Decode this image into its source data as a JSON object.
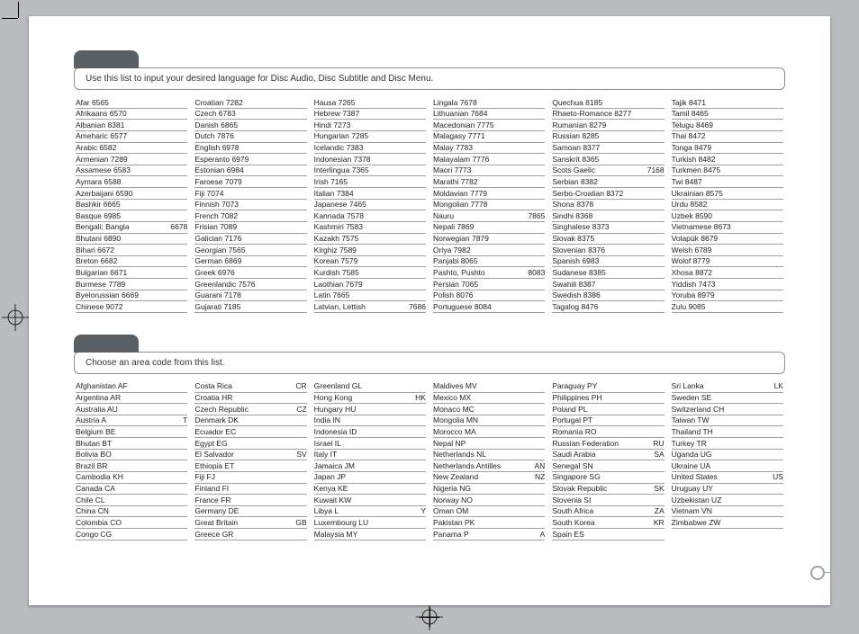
{
  "lang": {
    "instruction": "Use this list to input your desired language for Disc  Audio, Disc Subtitle and Disc Menu.",
    "cols": [
      [
        {
          "l": "Afar 6565"
        },
        {
          "l": "Afrikaans 6570"
        },
        {
          "l": "Albanian 8381"
        },
        {
          "l": "Ameharic 6577"
        },
        {
          "l": "Arabic 6582"
        },
        {
          "l": "Armenian 7289"
        },
        {
          "l": "Assamese 6583"
        },
        {
          "l": "Aymara 6588"
        },
        {
          "l": "Azerbaijani 6590"
        },
        {
          "l": "Bashkir 6665"
        },
        {
          "l": "Basque 6985"
        },
        {
          "l": "Bengali; Bangla",
          "r": "6678"
        },
        {
          "l": "Bhutani 6890"
        },
        {
          "l": "Bihari 6672"
        },
        {
          "l": "Breton 6682"
        },
        {
          "l": "Bulgarian 6671"
        },
        {
          "l": "Burmese 7789"
        },
        {
          "l": "Byelorussian 6669"
        },
        {
          "l": "Chinese 9072"
        }
      ],
      [
        {
          "l": "Croatian 7282"
        },
        {
          "l": "Czech 6783"
        },
        {
          "l": "Danish 6865"
        },
        {
          "l": "Dutch 7876"
        },
        {
          "l": "English 6978"
        },
        {
          "l": "Esperanto 6979"
        },
        {
          "l": "Estonian 6984"
        },
        {
          "l": "Faroese 7079"
        },
        {
          "l": "Fiji 7074"
        },
        {
          "l": "Finnish 7073"
        },
        {
          "l": "French 7082"
        },
        {
          "l": "Frisian 7089"
        },
        {
          "l": "Galician 7176"
        },
        {
          "l": "Georgian 7565"
        },
        {
          "l": "German 6869"
        },
        {
          "l": "Greek 6976"
        },
        {
          "l": "Greenlandic 7576"
        },
        {
          "l": "Guarani 7178"
        },
        {
          "l": "Gujarati 7185"
        }
      ],
      [
        {
          "l": "Hausa 7265"
        },
        {
          "l": "Hebrew 7387"
        },
        {
          "l": "Hindi 7273"
        },
        {
          "l": "Hungarian 7285"
        },
        {
          "l": "Icelandic 7383"
        },
        {
          "l": "Indonesian 7378"
        },
        {
          "l": "Interlingua 7365"
        },
        {
          "l": "Irish 7165"
        },
        {
          "l": "Italian 7384"
        },
        {
          "l": "Japanese 7465"
        },
        {
          "l": "Kannada 7578"
        },
        {
          "l": "Kashmiri 7583"
        },
        {
          "l": "Kazakh 7575"
        },
        {
          "l": "Kirghiz 7589"
        },
        {
          "l": "Korean 7579"
        },
        {
          "l": "Kurdish 7585"
        },
        {
          "l": "Laothian 7679"
        },
        {
          "l": "Latin 7665"
        },
        {
          "l": "Latvian, Lettish",
          "r": "7686"
        }
      ],
      [
        {
          "l": "Lingala 7678"
        },
        {
          "l": "Lithuanian 7684"
        },
        {
          "l": "Macedonian 7775"
        },
        {
          "l": "Malagasy 7771"
        },
        {
          "l": "Malay 7783"
        },
        {
          "l": "Malayalam 7776"
        },
        {
          "l": "Maori 7773"
        },
        {
          "l": "Marathi 7782"
        },
        {
          "l": "Moldavian 7779"
        },
        {
          "l": "Mongolian 7778"
        },
        {
          "l": "Nauru",
          "r": "7865"
        },
        {
          "l": "Nepali 7869"
        },
        {
          "l": "Norwegian 7879"
        },
        {
          "l": "Oriya 7982"
        },
        {
          "l": "Panjabi 8065"
        },
        {
          "l": "Pashto, Pushto",
          "r": "8083"
        },
        {
          "l": "Persian 7065"
        },
        {
          "l": "Polish 8076"
        },
        {
          "l": "Portuguese 8084"
        }
      ],
      [
        {
          "l": "Quechua 8185"
        },
        {
          "l": "Rhaeto-Romance 8277"
        },
        {
          "l": "Rumanian 8279"
        },
        {
          "l": "Russian 8285"
        },
        {
          "l": "Samoan 8377"
        },
        {
          "l": "Sanskrit 8365"
        },
        {
          "l": "Scots Gaelic",
          "r": "7168"
        },
        {
          "l": "Serbian 8382"
        },
        {
          "l": "Serbo-Croatian 8372"
        },
        {
          "l": "Shona 8378"
        },
        {
          "l": "Sindhi 8368"
        },
        {
          "l": "Singhalese 8373"
        },
        {
          "l": "Slovak 8375"
        },
        {
          "l": "Slovenian 8376"
        },
        {
          "l": "Spanish 6983"
        },
        {
          "l": "Sudanese 8385"
        },
        {
          "l": "Swahili 8387"
        },
        {
          "l": "Swedish 8386"
        },
        {
          "l": "Tagalog 8476"
        }
      ],
      [
        {
          "l": "Tajik 8471"
        },
        {
          "l": "Tamil 8465"
        },
        {
          "l": "Telugu 8469"
        },
        {
          "l": "Thai 8472"
        },
        {
          "l": "Tonga 8479"
        },
        {
          "l": "Turkish 8482"
        },
        {
          "l": "Turkmen 8475"
        },
        {
          "l": "Twi 8487"
        },
        {
          "l": "Ukrainian 8575"
        },
        {
          "l": "Urdu 8582"
        },
        {
          "l": "Uzbek 8590"
        },
        {
          "l": "Vietnamese 8673"
        },
        {
          "l": "Volapük 8679"
        },
        {
          "l": "Welsh 6789"
        },
        {
          "l": "Wolof 8779"
        },
        {
          "l": "Xhosa 8872"
        },
        {
          "l": "Yiddish 7473"
        },
        {
          "l": "Yoruba 8979"
        },
        {
          "l": "Zulu 9085"
        }
      ]
    ]
  },
  "area": {
    "instruction": "Choose an area code from this list.",
    "cols": [
      [
        {
          "l": "Afghanistan AF"
        },
        {
          "l": "Argentina AR"
        },
        {
          "l": "Australia AU"
        },
        {
          "l": "Austria A",
          "r": "T"
        },
        {
          "l": "Belgium BE"
        },
        {
          "l": "Bhutan BT"
        },
        {
          "l": "Bolivia BO"
        },
        {
          "l": "Brazil BR"
        },
        {
          "l": "Cambodia KH"
        },
        {
          "l": "Canada CA"
        },
        {
          "l": "Chile CL"
        },
        {
          "l": "China CN"
        },
        {
          "l": "Colombia CO"
        },
        {
          "l": "Congo CG"
        }
      ],
      [
        {
          "l": "Costa Rica",
          "r": "CR"
        },
        {
          "l": "Croatia HR"
        },
        {
          "l": "Czech Republic",
          "r": "CZ"
        },
        {
          "l": "Denmark DK"
        },
        {
          "l": "Ecuador EC"
        },
        {
          "l": "Egypt EG"
        },
        {
          "l": "El Salvador",
          "r": "SV"
        },
        {
          "l": "Ethiopia ET"
        },
        {
          "l": "Fiji FJ"
        },
        {
          "l": "Finland FI"
        },
        {
          "l": "France FR"
        },
        {
          "l": "Germany DE"
        },
        {
          "l": "Great Britain",
          "r": "GB"
        },
        {
          "l": "Greece GR"
        }
      ],
      [
        {
          "l": "Greenland GL"
        },
        {
          "l": "Hong Kong",
          "r": "HK"
        },
        {
          "l": "Hungary HU"
        },
        {
          "l": "India IN"
        },
        {
          "l": "Indonesia ID"
        },
        {
          "l": "Israel IL"
        },
        {
          "l": "Italy IT"
        },
        {
          "l": "Jamaica JM"
        },
        {
          "l": "Japan JP"
        },
        {
          "l": "Kenya KE"
        },
        {
          "l": "Kuwait KW"
        },
        {
          "l": "Libya L",
          "r": "Y"
        },
        {
          "l": "Luxembourg LU"
        },
        {
          "l": "Malaysia MY"
        }
      ],
      [
        {
          "l": "Maldives MV"
        },
        {
          "l": "Mexico MX"
        },
        {
          "l": "Monaco MC"
        },
        {
          "l": "Mongolia MN"
        },
        {
          "l": "Morocco MA"
        },
        {
          "l": "Nepal NP"
        },
        {
          "l": "Netherlands NL"
        },
        {
          "l": "Netherlands Antilles",
          "r": "AN"
        },
        {
          "l": "New Zealand",
          "r": "NZ"
        },
        {
          "l": "Nigeria NG"
        },
        {
          "l": "Norway NO"
        },
        {
          "l": "Oman OM"
        },
        {
          "l": "Pakistan PK"
        },
        {
          "l": "Panama P",
          "r": "A"
        }
      ],
      [
        {
          "l": "Paraguay PY"
        },
        {
          "l": "Philippines PH"
        },
        {
          "l": "Poland PL"
        },
        {
          "l": "Portugal PT"
        },
        {
          "l": "Romania RO"
        },
        {
          "l": "Russian Federation",
          "r": "RU"
        },
        {
          "l": "Saudi Arabia",
          "r": "SA"
        },
        {
          "l": "Senegal SN"
        },
        {
          "l": "Singapore SG"
        },
        {
          "l": "Slovak Republic",
          "r": "SK"
        },
        {
          "l": "Slovenia SI"
        },
        {
          "l": "South Africa",
          "r": "ZA"
        },
        {
          "l": "South Korea",
          "r": "KR"
        },
        {
          "l": "Spain ES"
        }
      ],
      [
        {
          "l": "Sri Lanka",
          "r": "LK"
        },
        {
          "l": "Sweden SE"
        },
        {
          "l": "Switzerland CH"
        },
        {
          "l": "Taiwan TW"
        },
        {
          "l": "Thailand TH"
        },
        {
          "l": "Turkey TR"
        },
        {
          "l": "Uganda UG"
        },
        {
          "l": "Ukraine UA"
        },
        {
          "l": "United States",
          "r": "US"
        },
        {
          "l": "Uruguay UY"
        },
        {
          "l": "Uzbekistan UZ"
        },
        {
          "l": "Vietnam VN"
        },
        {
          "l": "Zimbabwe ZW"
        }
      ]
    ]
  }
}
